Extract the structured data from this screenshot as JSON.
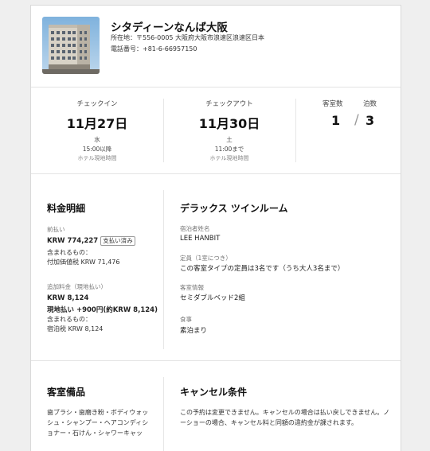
{
  "hotel": {
    "name": "シタディーンなんば大阪",
    "address": "所在地：〒556-0005 大阪府大阪市浪速区浪速区日本",
    "phone": "電話番号：+81-6-66957150"
  },
  "checkin": {
    "label": "チェックイン",
    "date": "11月27日",
    "weekday": "水",
    "time": "15:00以降",
    "tz_note": "ホテル現地時間"
  },
  "checkout": {
    "label": "チェックアウト",
    "date": "11月30日",
    "weekday": "土",
    "time": "11:00まで",
    "tz_note": "ホテル現地時間"
  },
  "stay": {
    "rooms_label": "客室数",
    "nights_label": "泊数",
    "rooms": "1",
    "separator": "/",
    "nights": "3"
  },
  "price": {
    "title": "料金明細",
    "prepaid_label": "前払い",
    "prepaid_amount": "KRW 774,227",
    "prepaid_status": "支払い済み",
    "included_label": "含まれるもの：",
    "prepaid_tax": "付加価値税 KRW 71,476",
    "extra_label": "追加料金（現地払い）",
    "extra_amount": "KRW 8,124",
    "local_pay": "現地払い +900円(約KRW 8,124)",
    "included_label2": "含まれるもの：",
    "extra_tax": "宿泊税 KRW 8,124"
  },
  "room": {
    "title": "デラックス ツインルーム",
    "guest_label": "宿泊者姓名",
    "guest_name": "LEE HANBIT",
    "capacity_label": "定員（1室につき）",
    "capacity": "この客室タイプの定員は3名です（うち大人3名まで）",
    "info_label": "客室情報",
    "beds": "セミダブルベッド2組",
    "meal_label": "食事",
    "meal": "素泊まり"
  },
  "amenities": {
    "title": "客室備品",
    "line1": "歯ブラシ・歯磨き粉・ボディウォッ",
    "line2": "シュ・シャンプー・ヘアコンディシ",
    "line3": "ョナー・石けん・シャワーキャッ"
  },
  "cancel": {
    "title": "キャンセル条件",
    "line1": "この予約は変更できません。キャンセルの場合は払い戻しできません。ノ",
    "line2": "ーショーの場合、キャンセル料と同額の違約金が課されます。"
  }
}
